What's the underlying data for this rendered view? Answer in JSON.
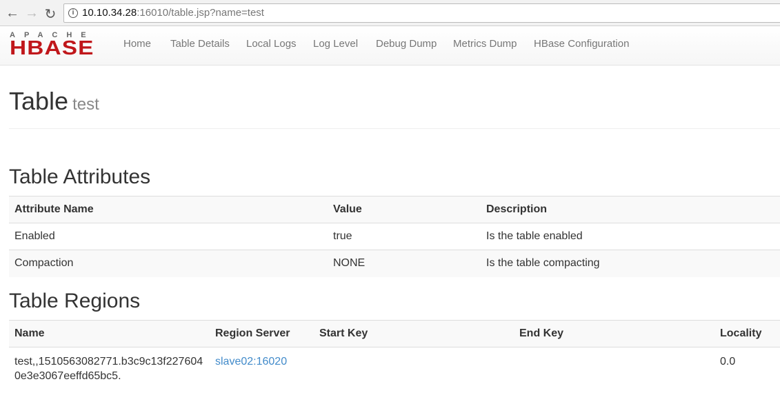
{
  "browser": {
    "url_host": "10.10.34.28",
    "url_rest": ":16010/table.jsp?name=test"
  },
  "logo": {
    "top": "APACHE",
    "main": "HBASE"
  },
  "nav": [
    "Home",
    "Table Details",
    "Local Logs",
    "Log Level",
    "Debug Dump",
    "Metrics Dump",
    "HBase Configuration"
  ],
  "page": {
    "title": "Table",
    "subtitle": "test"
  },
  "attributes": {
    "heading": "Table Attributes",
    "columns": [
      "Attribute Name",
      "Value",
      "Description"
    ],
    "rows": [
      [
        "Enabled",
        "true",
        "Is the table enabled"
      ],
      [
        "Compaction",
        "NONE",
        "Is the table compacting"
      ]
    ]
  },
  "regions": {
    "heading": "Table Regions",
    "columns": [
      "Name",
      "Region Server",
      "Start Key",
      "End Key",
      "Locality"
    ],
    "rows": [
      {
        "name_line1": "test,,1510563082771.b3c9c13f227604",
        "name_line2": "0e3e3067eeffd65bc5.",
        "server": "slave02:16020",
        "start_key": "",
        "end_key": "",
        "locality": "0.0"
      }
    ]
  }
}
